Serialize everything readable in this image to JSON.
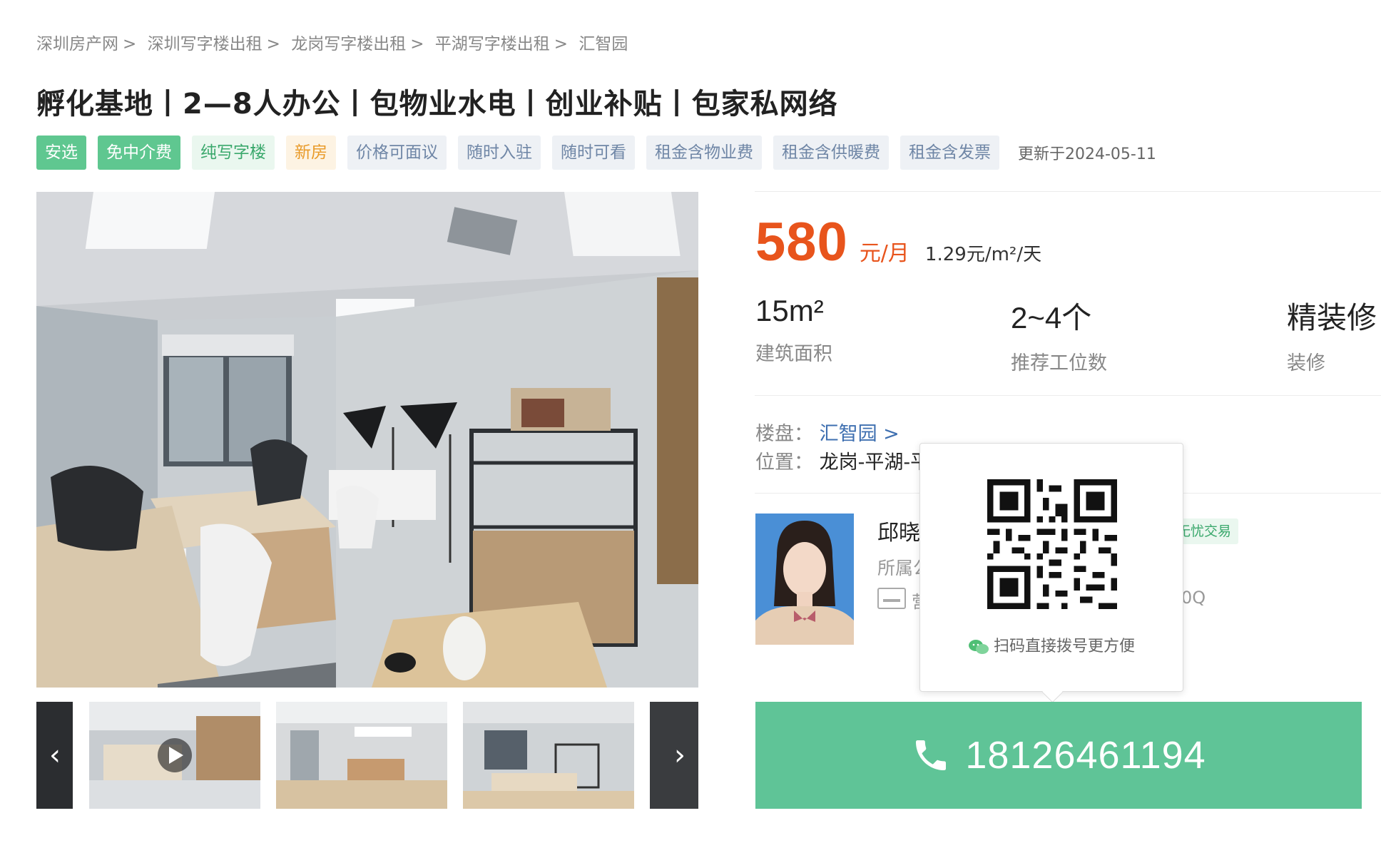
{
  "breadcrumb": [
    {
      "label": "深圳房产网"
    },
    {
      "label": "深圳写字楼出租"
    },
    {
      "label": "龙岗写字楼出租"
    },
    {
      "label": "平湖写字楼出租"
    },
    {
      "label": "汇智园"
    }
  ],
  "title": "孵化基地丨2—8人办公丨包物业水电丨创业补贴丨包家私网络",
  "tags": [
    "安选",
    "免中介费",
    "纯写字楼",
    "新房",
    "价格可面议",
    "随时入驻",
    "随时可看",
    "租金含物业费",
    "租金含供暖费",
    "租金含发票"
  ],
  "updated": "更新于2024-05-11",
  "price": {
    "value": "580",
    "unit": "元/月",
    "per_area": "1.29元/m²/天"
  },
  "stats": [
    {
      "value": "15m²",
      "label": "建筑面积"
    },
    {
      "value": "2~4个",
      "label": "推荐工位数"
    },
    {
      "value": "精装修",
      "label": "装修"
    }
  ],
  "info": {
    "building_label": "楼盘：",
    "building_value": "汇智园 >",
    "location_label": "位置：",
    "location_value": "龙岗-平湖-平"
  },
  "agent": {
    "name": "邱晓",
    "company_label": "所属公",
    "license_prefix": "营",
    "license_suffix": "0Q",
    "badge": "无忧交易"
  },
  "qr_popup": {
    "hint": "扫码直接拨号更方便"
  },
  "phone": "18126461194",
  "colors": {
    "accent": "#5fc497",
    "price": "#e8541c",
    "link": "#3e6fb0"
  }
}
